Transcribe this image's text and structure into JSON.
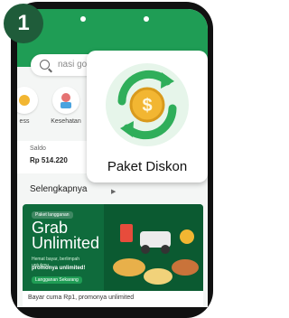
{
  "step": {
    "number": "1"
  },
  "search": {
    "placeholder": "nasi goreng"
  },
  "services": [
    {
      "label": "ess",
      "icon": "service-icon"
    },
    {
      "label": "Kesehatan",
      "icon": "health-icon"
    }
  ],
  "balance": {
    "label": "Saldo",
    "value": "Rp 514.220"
  },
  "section": {
    "see_more": "Selengkapnya",
    "see_more_icon": "chevron-right-icon"
  },
  "promo": {
    "tag": "Paket langganan",
    "title_line1": "Grab",
    "title_line2": "Unlimited",
    "subtitle": "Hemat bayar, berlimpah untukmu",
    "highlight": "promonya unlimited!",
    "cta": "Langganan Sekarang",
    "caption": "Bayar cuma Rp1, promonya unlimited"
  },
  "feature": {
    "label": "Paket Diskon",
    "icon": "discount-package-icon"
  },
  "colors": {
    "brand_green": "#1f9d55",
    "dark_green": "#1f5c3a",
    "coin": "#f2b632"
  }
}
